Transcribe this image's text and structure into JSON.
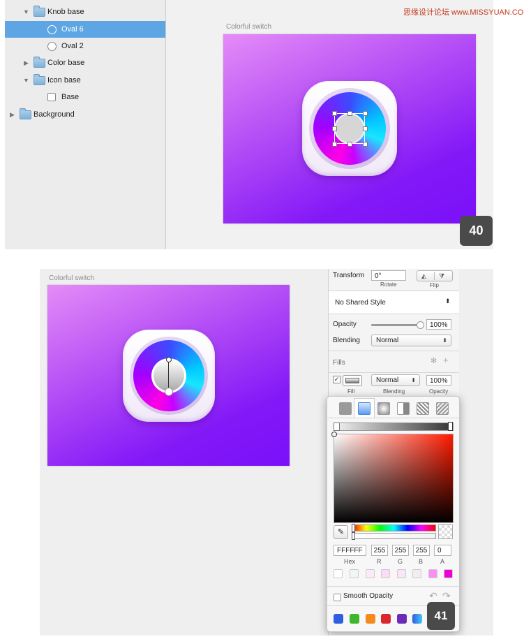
{
  "watermark": "思缘设计论坛 www.MISSYUAN.COM",
  "panel1": {
    "layers": [
      {
        "label": "Knob base"
      },
      {
        "label": "Oval 6"
      },
      {
        "label": "Oval 2"
      },
      {
        "label": "Color base"
      },
      {
        "label": "Icon base"
      },
      {
        "label": "Base"
      },
      {
        "label": "Background"
      }
    ],
    "artboard_title": "Colorful switch",
    "step_badge": "40"
  },
  "panel2": {
    "artboard_title": "Colorful switch",
    "step_badge": "41",
    "inspector": {
      "transform_label": "Transform",
      "rotate_value": "0°",
      "rotate_label": "Rotate",
      "flip_label": "Flip",
      "shared_style": "No Shared Style",
      "opacity_label": "Opacity",
      "opacity_value": "100%",
      "opacity_level": 1.0,
      "blending_label": "Blending",
      "blending_value": "Normal",
      "fills_label": "Fills",
      "fill_blend_value": "Normal",
      "fill_opacity_value": "100%",
      "fill_caption": "Fill",
      "fill_blend_caption": "Blending",
      "fill_opacity_caption": "Opacity"
    },
    "color_picker": {
      "hex": "FFFFFF",
      "r": "255",
      "g": "255",
      "b": "255",
      "a": "0",
      "hex_label": "Hex",
      "r_label": "R",
      "g_label": "G",
      "b_label": "B",
      "a_label": "A",
      "doc_swatches": [
        "#ffffff",
        "#f4f4f4",
        "#fde9fb",
        "#fcdaf8",
        "#fae6f6",
        "#f1eef2",
        "#f98ff0",
        "#f000d8"
      ],
      "smooth_opacity_label": "Smooth Opacity",
      "global_swatches": [
        "#2f5fe0",
        "#3fb72c",
        "#f48a1e",
        "#d8282d",
        "#6a2bb8",
        "#2f8ff0"
      ]
    }
  }
}
